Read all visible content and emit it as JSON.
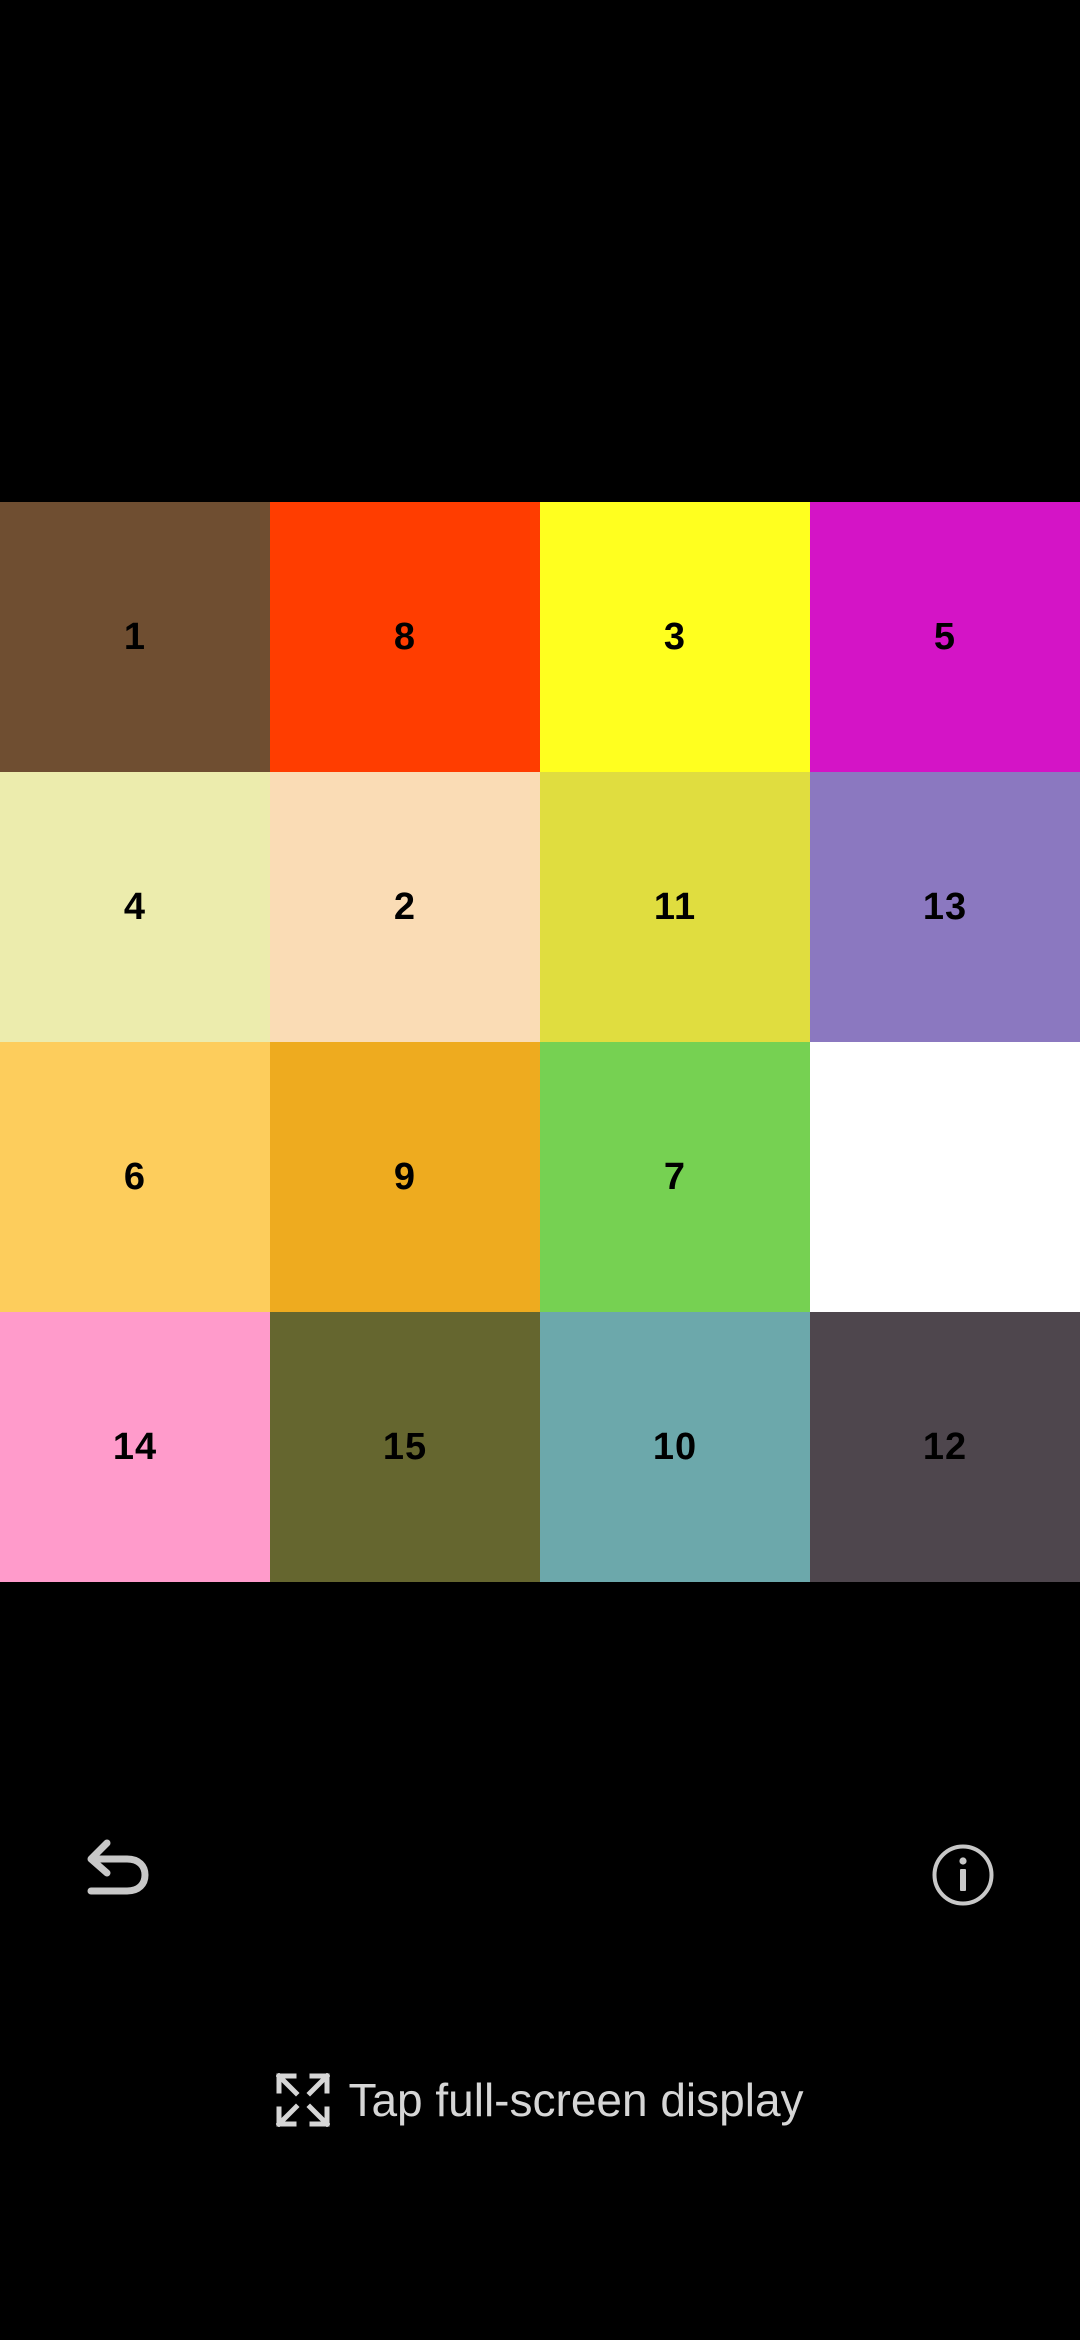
{
  "board": {
    "tiles": [
      {
        "label": "1",
        "color": "#6f4e31"
      },
      {
        "label": "8",
        "color": "#ff3d00"
      },
      {
        "label": "3",
        "color": "#ffff1f"
      },
      {
        "label": "5",
        "color": "#d414c6"
      },
      {
        "label": "4",
        "color": "#ececad"
      },
      {
        "label": "2",
        "color": "#fadcb5"
      },
      {
        "label": "11",
        "color": "#e0dd3f"
      },
      {
        "label": "13",
        "color": "#8b78c0"
      },
      {
        "label": "6",
        "color": "#fdcd5c"
      },
      {
        "label": "9",
        "color": "#eeab1f"
      },
      {
        "label": "7",
        "color": "#76d152"
      },
      {
        "label": "",
        "color": "#ffffff",
        "empty": true
      },
      {
        "label": "14",
        "color": "#ff9bcb"
      },
      {
        "label": "15",
        "color": "#65662f"
      },
      {
        "label": "10",
        "color": "#6ca8ab"
      },
      {
        "label": "12",
        "color": "#4e464d"
      }
    ]
  },
  "controls": {
    "undo_icon": "undo-arrow-icon",
    "info_icon": "info-icon",
    "icon_color": "#c8c8c8"
  },
  "footer": {
    "fullscreen_icon": "expand-arrows-icon",
    "fullscreen_label": "Tap full-screen display"
  }
}
